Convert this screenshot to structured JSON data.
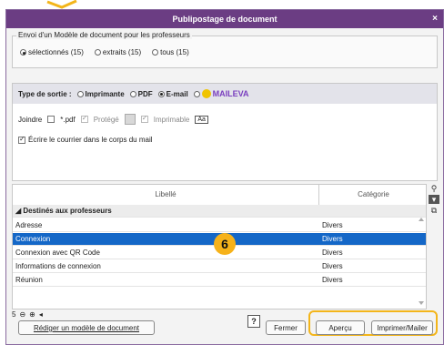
{
  "window": {
    "title": "Publipostage de document",
    "close_label": "×"
  },
  "envoi": {
    "legend": "Envoi d'un Modèle de document pour les professeurs",
    "options": [
      {
        "label": "sélectionnés (15)",
        "checked": true
      },
      {
        "label": "extraits (15)",
        "checked": false
      },
      {
        "label": "tous (15)",
        "checked": false
      }
    ]
  },
  "sortie": {
    "label": "Type de sortie :",
    "options": [
      {
        "label": "Imprimante",
        "checked": false
      },
      {
        "label": "PDF",
        "checked": false
      },
      {
        "label": "E-mail",
        "checked": true
      },
      {
        "label": "MAILEVA",
        "checked": false
      }
    ]
  },
  "joindre": {
    "label": "Joindre",
    "pdf_label": "*.pdf",
    "protege_label": "Protégé",
    "imprimable_label": "Imprimable",
    "aa_label": "Aa"
  },
  "courrier": {
    "label": "Écrire le courrier dans le corps du mail",
    "checked": true
  },
  "grid": {
    "col_libelle": "Libellé",
    "col_categorie": "Catégorie",
    "group_label": "◢ Destinés aux professeurs",
    "rows": [
      {
        "libelle": "Adresse",
        "categorie": "Divers"
      },
      {
        "libelle": "Connexion",
        "categorie": "Divers",
        "selected": true
      },
      {
        "libelle": "Connexion avec QR Code",
        "categorie": "Divers"
      },
      {
        "libelle": "Informations de connexion",
        "categorie": "Divers"
      },
      {
        "libelle": "Réunion",
        "categorie": "Divers"
      }
    ],
    "count": "5"
  },
  "footer": {
    "rediger_label": "Rédiger un modèle de document",
    "help_label": "?",
    "fermer_label": "Fermer",
    "apercu_label": "Aperçu",
    "imprimer_label": "Imprimer/Mailer"
  },
  "badge": "6",
  "colors": {
    "title_bar": "#6b3d83",
    "selection": "#1467c7",
    "highlight": "#f3b51a",
    "maileva": "#7a3fbf"
  }
}
